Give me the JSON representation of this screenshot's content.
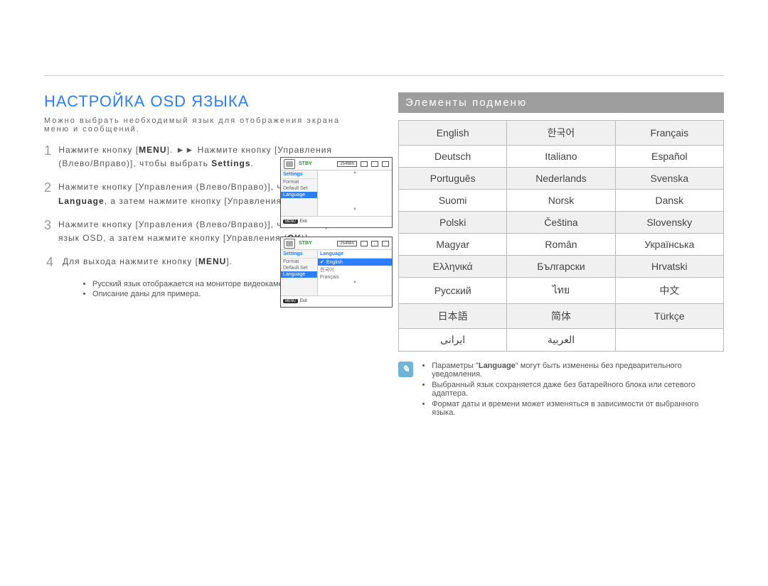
{
  "title": "НАСТРОЙКА OSD ЯЗЫКА",
  "subtitle": "Можно выбрать необходимый язык для отображения экрана меню и сообщений.",
  "steps": [
    {
      "n": "1",
      "html": "Нажмите кнопку [<b>MENU</b>]. ►► Нажмите кнопку [Управления (Влево/Вправо)], чтобы выбрать <b>Settings</b>."
    },
    {
      "n": "2",
      "html": "Нажмите кнопку [Управления (Влево/Вправо)], чтобы выбрать <b>Language</b>, а затем нажмите кнопку [Управления (<b>OK</b>)]."
    },
    {
      "n": "3",
      "html": "Нажмите кнопку [Управления (Влево/Вправо)], чтобы выбрать язык OSD, а затем нажмите кнопку [Управления (<b>OK</b>)]."
    },
    {
      "n": "4",
      "html": "Для выхода нажмите кнопку [<b>MENU</b>]."
    }
  ],
  "bullets": [
    "Русский язык отображается на мониторе видеокамеры.",
    "Описание даны для примера."
  ],
  "panel": {
    "stby": "STBY",
    "minutes": "254Min",
    "exit": "Exit",
    "menuTag": "MENU",
    "settings": "Settings",
    "format": "Format",
    "defaultSet": "Default Set",
    "language": "Language",
    "english": "English",
    "francais": "Français",
    "garbled1": "한국어"
  },
  "rightHeaderIcon": "■",
  "rightHeader": "Элементы подменю",
  "langTable": [
    [
      "English",
      "한국어",
      "Français"
    ],
    [
      "Deutsch",
      "Italiano",
      "Español"
    ],
    [
      "Português",
      "Nederlands",
      "Svenska"
    ],
    [
      "Suomi",
      "Norsk",
      "Dansk"
    ],
    [
      "Polski",
      "Čeština",
      "Slovensky"
    ],
    [
      "Magyar",
      "Român",
      "Украïнська"
    ],
    [
      "Ελληνικά",
      "Български",
      "Hrvatski"
    ],
    [
      "Русский",
      "ไทย",
      "中文"
    ],
    [
      "日本語",
      "简体",
      "Türkçe"
    ],
    [
      "ایرانی",
      "العربية",
      ""
    ]
  ],
  "notes": [
    "Параметры \"<b>Language</b>\" могут быть изменены без предварительного уведомления.",
    "Выбранный язык сохраняется даже без батарейного блока или сетевого адаптера.",
    "Формат даты и времени может изменяться в зависимости от выбранного языка."
  ]
}
